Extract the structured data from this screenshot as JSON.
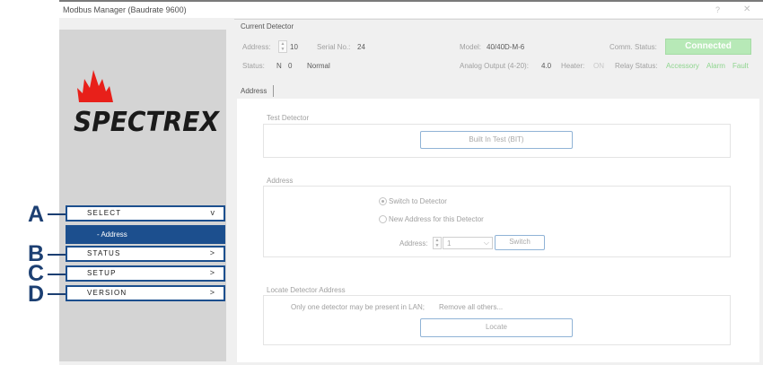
{
  "window": {
    "title": "Modbus Manager (Baudrate 9600)",
    "help_glyph": "?",
    "close_glyph": "✕"
  },
  "sidebar": {
    "logo_text": "SPECTREX",
    "nav": [
      {
        "label": "SELECT",
        "chevron": "v",
        "callout": "A"
      },
      {
        "label": "STATUS",
        "chevron": ">",
        "callout": "B"
      },
      {
        "label": "SETUP",
        "chevron": ">",
        "callout": "C"
      },
      {
        "label": "VERSION",
        "chevron": ">",
        "callout": "D"
      }
    ],
    "sub_item": "-  Address"
  },
  "current_detector": {
    "header": "Current Detector",
    "address_label": "Address:",
    "address_value": "10",
    "serial_label": "Serial No.:",
    "serial_value": "24",
    "model_label": "Model:",
    "model_value": "40/40D-M-6",
    "comm_label": "Comm. Status:",
    "comm_value": "Connected",
    "status_label": "Status:",
    "status_n": "N",
    "status_code": "0",
    "status_text": "Normal",
    "analog_label": "Analog Output (4-20):",
    "analog_value": "4.0",
    "heater_label": "Heater:",
    "heater_value": "ON",
    "relay_label": "Relay Status:",
    "relays": [
      "Accessory",
      "Alarm",
      "Fault"
    ],
    "accent_color": "#b7e9b7"
  },
  "tabs": [
    "Address"
  ],
  "test_detector": {
    "title": "Test Detector",
    "bit_button": "Built In Test (BIT)"
  },
  "address_group": {
    "title": "Address",
    "radio_switch": "Switch to Detector",
    "radio_new": "New Address for this Detector",
    "address_label": "Address:",
    "address_select": "1",
    "switch_button": "Switch"
  },
  "locate_group": {
    "title": "Locate Detector Address",
    "note": "Only one detector may be present in LAN;",
    "note2": "Remove all others...",
    "locate_button": "Locate"
  },
  "colors": {
    "nav_border": "#1c4f8e",
    "callout": "#1c3f72",
    "flame": "#e8201a"
  }
}
